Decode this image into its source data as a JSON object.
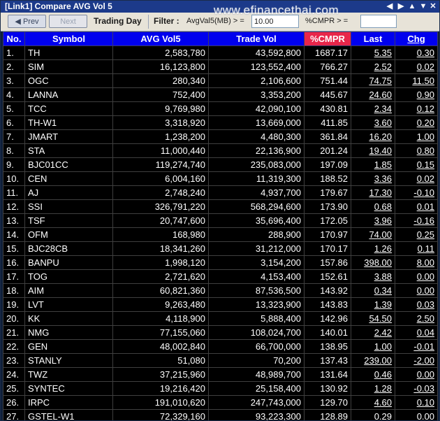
{
  "window": {
    "title": "[Link1] Compare AVG Vol 5"
  },
  "toolbar": {
    "prev_label": "Prev",
    "next_label": "Next",
    "trading_day_label": "Trading Day",
    "filter_label": "Filter :",
    "avgvol_label": "AvgVal5(MB) > =",
    "avgvol_value": "10.00",
    "cmpr_label": "%CMPR > =",
    "cmpr_value": ""
  },
  "watermark": "www.efinancethai.com",
  "icons": {
    "title_left": "arrow-left-icon",
    "title_right": "arrow-right-icon",
    "title_up": "arrow-up-icon",
    "title_down": "arrow-down-icon",
    "title_close": "close-icon",
    "prev": "prev-arrow-icon"
  },
  "colors": {
    "up": "#1ee01e",
    "down": "#ff2a2a",
    "unchanged": "#ffe600",
    "header_bg": "#0000ee",
    "cmpr_header_bg": "#e8264a"
  },
  "table": {
    "headers": [
      "No.",
      "Symbol",
      "AVG Vol5",
      "Trade Vol",
      "%CMPR",
      "Last",
      "Chg"
    ],
    "rows": [
      {
        "no": "1.",
        "sym": "TH",
        "avg": "2,583,780",
        "trade": "43,592,800",
        "cmpr": "1687.17",
        "last": "5.35",
        "chg": "0.30",
        "st": "up"
      },
      {
        "no": "2.",
        "sym": "SIM",
        "avg": "16,123,800",
        "trade": "123,552,400",
        "cmpr": "766.27",
        "last": "2.52",
        "chg": "0.02",
        "st": "up"
      },
      {
        "no": "3.",
        "sym": "OGC",
        "avg": "280,340",
        "trade": "2,106,600",
        "cmpr": "751.44",
        "last": "74.75",
        "chg": "11.50",
        "st": "up"
      },
      {
        "no": "4.",
        "sym": "LANNA",
        "avg": "752,400",
        "trade": "3,353,200",
        "cmpr": "445.67",
        "last": "24.60",
        "chg": "0.90",
        "st": "up"
      },
      {
        "no": "5.",
        "sym": "TCC",
        "avg": "9,769,980",
        "trade": "42,090,100",
        "cmpr": "430.81",
        "last": "2.34",
        "chg": "0.12",
        "st": "up"
      },
      {
        "no": "6.",
        "sym": "TH-W1",
        "avg": "3,318,920",
        "trade": "13,669,000",
        "cmpr": "411.85",
        "last": "3.60",
        "chg": "0.20",
        "st": "up"
      },
      {
        "no": "7.",
        "sym": "JMART",
        "avg": "1,238,200",
        "trade": "4,480,300",
        "cmpr": "361.84",
        "last": "16.20",
        "chg": "1.00",
        "st": "up"
      },
      {
        "no": "8.",
        "sym": "STA",
        "avg": "11,000,440",
        "trade": "22,136,900",
        "cmpr": "201.24",
        "last": "19.40",
        "chg": "0.80",
        "st": "up"
      },
      {
        "no": "9.",
        "sym": "BJC01CC",
        "avg": "119,274,740",
        "trade": "235,083,000",
        "cmpr": "197.09",
        "last": "1.85",
        "chg": "0.15",
        "st": "up"
      },
      {
        "no": "10.",
        "sym": "CEN",
        "avg": "6,004,160",
        "trade": "11,319,300",
        "cmpr": "188.52",
        "last": "3.36",
        "chg": "0.02",
        "st": "up"
      },
      {
        "no": "11.",
        "sym": "AJ",
        "avg": "2,748,240",
        "trade": "4,937,700",
        "cmpr": "179.67",
        "last": "17.30",
        "chg": "-0.10",
        "st": "dn"
      },
      {
        "no": "12.",
        "sym": "SSI",
        "avg": "326,791,220",
        "trade": "568,294,600",
        "cmpr": "173.90",
        "last": "0.68",
        "chg": "0.01",
        "st": "up"
      },
      {
        "no": "13.",
        "sym": "TSF",
        "avg": "20,747,600",
        "trade": "35,696,400",
        "cmpr": "172.05",
        "last": "3.96",
        "chg": "-0.16",
        "st": "dn"
      },
      {
        "no": "14.",
        "sym": "OFM",
        "avg": "168,980",
        "trade": "288,900",
        "cmpr": "170.97",
        "last": "74.00",
        "chg": "0.25",
        "st": "up"
      },
      {
        "no": "15.",
        "sym": "BJC28CB",
        "avg": "18,341,260",
        "trade": "31,212,000",
        "cmpr": "170.17",
        "last": "1.26",
        "chg": "0.11",
        "st": "up"
      },
      {
        "no": "16.",
        "sym": "BANPU",
        "avg": "1,998,120",
        "trade": "3,154,200",
        "cmpr": "157.86",
        "last": "398.00",
        "chg": "8.00",
        "st": "up"
      },
      {
        "no": "17.",
        "sym": "TOG",
        "avg": "2,721,620",
        "trade": "4,153,400",
        "cmpr": "152.61",
        "last": "3.88",
        "chg": "0.00",
        "st": "eq"
      },
      {
        "no": "18.",
        "sym": "AIM",
        "avg": "60,821,360",
        "trade": "87,536,500",
        "cmpr": "143.92",
        "last": "0.34",
        "chg": "0.00",
        "st": "eq"
      },
      {
        "no": "19.",
        "sym": "LVT",
        "avg": "9,263,480",
        "trade": "13,323,900",
        "cmpr": "143.83",
        "last": "1.39",
        "chg": "0.03",
        "st": "up"
      },
      {
        "no": "20.",
        "sym": "KK",
        "avg": "4,118,900",
        "trade": "5,888,400",
        "cmpr": "142.96",
        "last": "54.50",
        "chg": "2.50",
        "st": "up"
      },
      {
        "no": "21.",
        "sym": "NMG",
        "avg": "77,155,060",
        "trade": "108,024,700",
        "cmpr": "140.01",
        "last": "2.42",
        "chg": "0.04",
        "st": "up"
      },
      {
        "no": "22.",
        "sym": "GEN",
        "avg": "48,002,840",
        "trade": "66,700,000",
        "cmpr": "138.95",
        "last": "1.00",
        "chg": "-0.01",
        "st": "dn"
      },
      {
        "no": "23.",
        "sym": "STANLY",
        "avg": "51,080",
        "trade": "70,200",
        "cmpr": "137.43",
        "last": "239.00",
        "chg": "-2.00",
        "st": "dn"
      },
      {
        "no": "24.",
        "sym": "TWZ",
        "avg": "37,215,960",
        "trade": "48,989,700",
        "cmpr": "131.64",
        "last": "0.46",
        "chg": "0.00",
        "st": "eq"
      },
      {
        "no": "25.",
        "sym": "SYNTEC",
        "avg": "19,216,420",
        "trade": "25,158,400",
        "cmpr": "130.92",
        "last": "1.28",
        "chg": "-0.03",
        "st": "dn"
      },
      {
        "no": "26.",
        "sym": "IRPC",
        "avg": "191,010,620",
        "trade": "247,743,000",
        "cmpr": "129.70",
        "last": "4.60",
        "chg": "0.10",
        "st": "up"
      },
      {
        "no": "27.",
        "sym": "GSTEL-W1",
        "avg": "72,329,160",
        "trade": "93,223,300",
        "cmpr": "128.89",
        "last": "0.29",
        "chg": "0.00",
        "st": "eq"
      }
    ]
  }
}
